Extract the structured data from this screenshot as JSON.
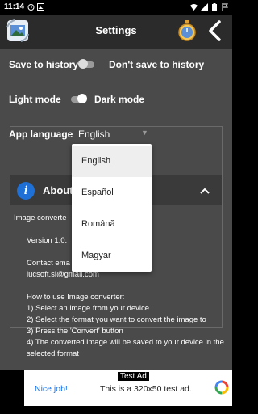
{
  "status_bar": {
    "time": "11:14"
  },
  "app_bar": {
    "title": "Settings"
  },
  "settings": {
    "history": {
      "left_label": "Save to history",
      "right_label": "Don't save to history",
      "on": false
    },
    "theme": {
      "left_label": "Light mode",
      "right_label": "Dark mode",
      "on": true
    },
    "language": {
      "label": "App language",
      "value": "English"
    }
  },
  "about": {
    "title": "About",
    "lines": [
      "Image converte",
      "Version 1.0.",
      "Contact ema",
      "lucsoft.sl@gmail.com",
      "How to use Image converter:",
      "1) Select an image from your device",
      "2) Select the format you want to convert the image to",
      "3) Press the 'Convert' button",
      "4) The converted image will be saved to your device in the selected format"
    ]
  },
  "language_dropdown": {
    "options": [
      "English",
      "Español",
      "Română",
      "Magyar"
    ],
    "selected": "English"
  },
  "ad": {
    "label": "Test Ad",
    "cta": "Nice job!",
    "text": "This is a 320x50 test ad."
  },
  "colors": {
    "accent": "#1e6fd6",
    "toolbar": "#2b2b2b",
    "background": "#4a4a4a",
    "ad_link": "#1a73e8"
  }
}
